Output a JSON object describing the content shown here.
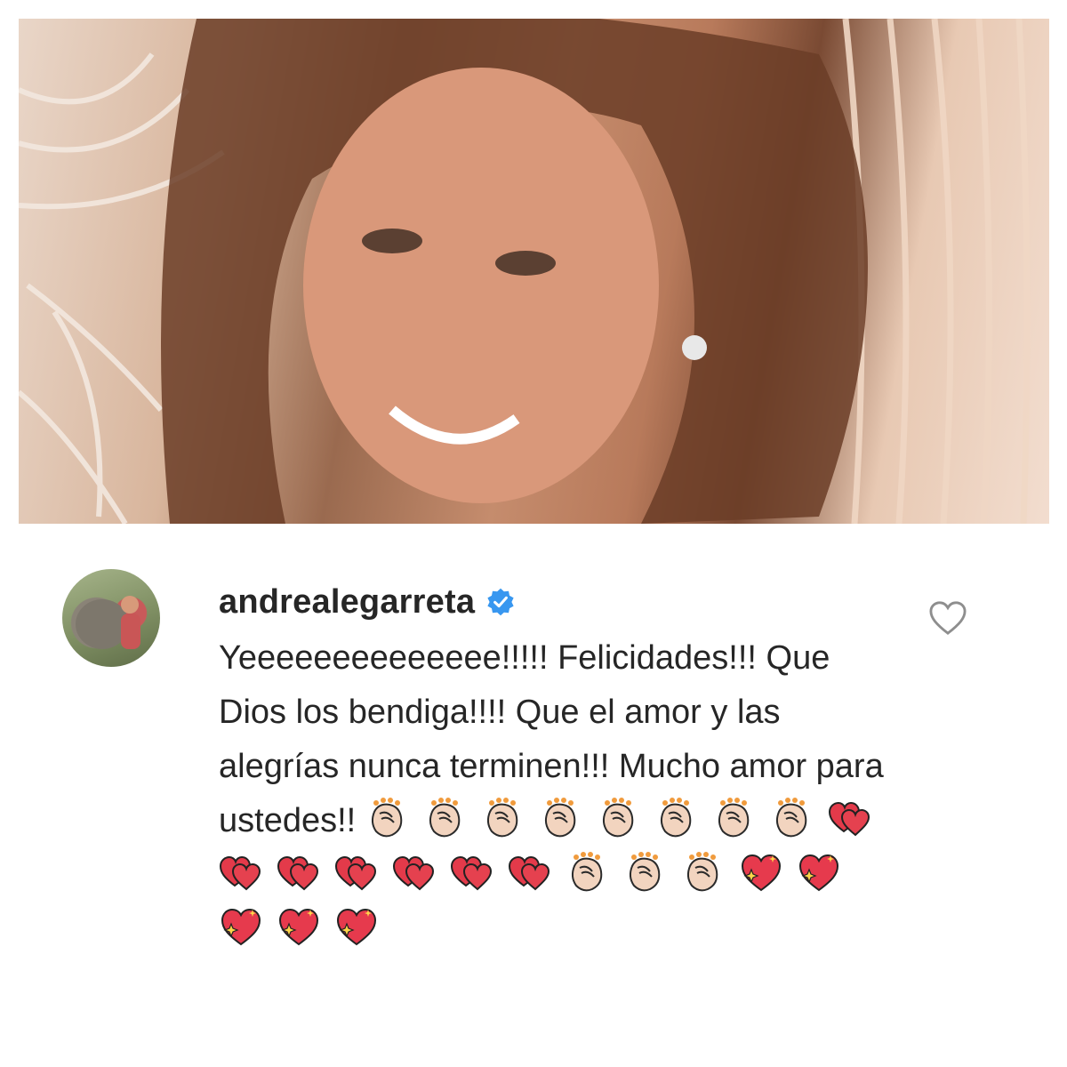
{
  "photo": {
    "alt": ""
  },
  "comment": {
    "username": "andrealegarreta",
    "verified": true,
    "text": "Yeeeeeeeeeeeeee!!!!! Felicidades!!! Que Dios los bendiga!!!! Que el amor y las alegrías nunca terminen!!! Mucho amor para ustedes!!",
    "emojis": [
      "clap",
      "clap",
      "clap",
      "clap",
      "clap",
      "clap",
      "clap",
      "clap",
      "hearts",
      "hearts",
      "hearts",
      "hearts",
      "hearts",
      "hearts",
      "hearts",
      "clap",
      "clap",
      "clap",
      "sparkle-heart",
      "sparkle-heart",
      "sparkle-heart",
      "sparkle-heart",
      "sparkle-heart"
    ],
    "colors": {
      "text": "#262626",
      "verified": "#3897f0",
      "like_icon": "#8e8e8e"
    }
  }
}
